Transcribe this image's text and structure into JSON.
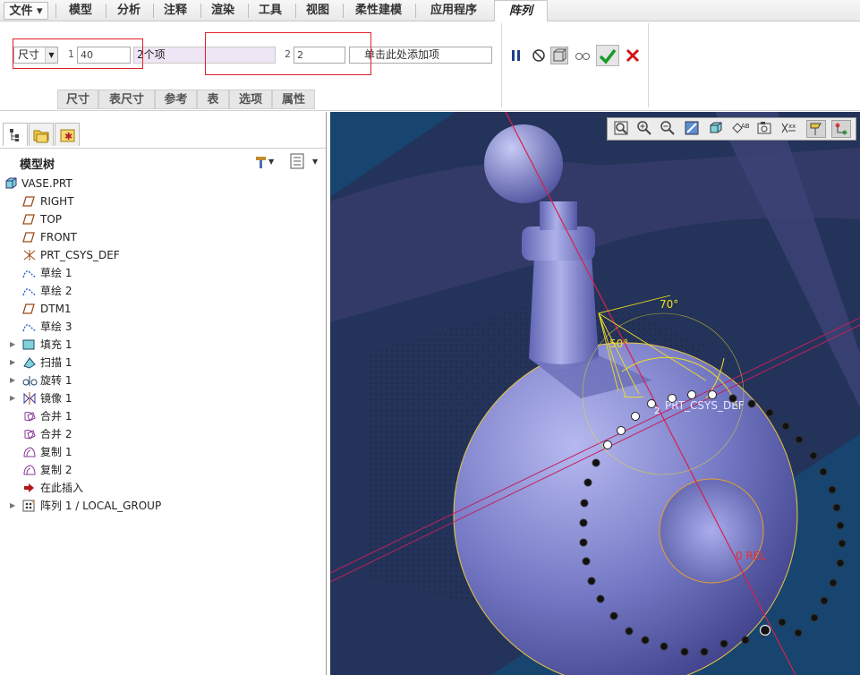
{
  "menubar": {
    "items": [
      "文件 ▾",
      "模型",
      "分析",
      "注释",
      "渲染",
      "工具",
      "视图",
      "柔性建模",
      "应用程序"
    ],
    "active_tab": "阵列"
  },
  "ribbon": {
    "dim_type": "尺寸",
    "dir1_index": "1",
    "dir1_value": "40",
    "dir1_items": "2个项",
    "dir2_index": "2",
    "dir2_value": "2",
    "dir2_hint": "单击此处添加项",
    "subtabs": [
      "尺寸",
      "表尺寸",
      "参考",
      "表",
      "选项",
      "属性"
    ],
    "buttons": {
      "pause": "pause-icon",
      "no_preview": "no-preview-icon",
      "preview": "preview-icon",
      "glasses": "glasses-icon",
      "ok": "checkmark-icon",
      "cancel": "cancel-x-icon"
    },
    "colors": {
      "ok": "#1a9a2a",
      "cancel": "#d01515",
      "highlight_box": "#e0202a"
    }
  },
  "navigator": {
    "title": "模型树",
    "root": "VASE.PRT",
    "items": [
      {
        "label": "RIGHT",
        "icon": "datum-plane-icon",
        "expandable": false
      },
      {
        "label": "TOP",
        "icon": "datum-plane-icon",
        "expandable": false
      },
      {
        "label": "FRONT",
        "icon": "datum-plane-icon",
        "expandable": false
      },
      {
        "label": "PRT_CSYS_DEF",
        "icon": "csys-icon",
        "expandable": false
      },
      {
        "label": "草绘 1",
        "icon": "sketch-icon",
        "expandable": false
      },
      {
        "label": "草绘 2",
        "icon": "sketch-icon",
        "expandable": false
      },
      {
        "label": "DTM1",
        "icon": "datum-plane-icon",
        "expandable": false
      },
      {
        "label": "草绘 3",
        "icon": "sketch-icon",
        "expandable": false
      },
      {
        "label": "填充 1",
        "icon": "fill-icon",
        "expandable": true
      },
      {
        "label": "扫描 1",
        "icon": "sweep-icon",
        "expandable": true
      },
      {
        "label": "旋转 1",
        "icon": "revolve-icon",
        "expandable": true
      },
      {
        "label": "镜像 1",
        "icon": "mirror-icon",
        "expandable": true
      },
      {
        "label": "合并 1",
        "icon": "merge-icon",
        "expandable": false
      },
      {
        "label": "合并 2",
        "icon": "merge-icon",
        "expandable": false
      },
      {
        "label": "复制 1",
        "icon": "copy-icon",
        "expandable": false
      },
      {
        "label": "复制 2",
        "icon": "copy-icon",
        "expandable": false
      },
      {
        "label": "在此插入",
        "icon": "insert-here-icon",
        "expandable": false
      },
      {
        "label": "阵列 1 / LOCAL_GROUP",
        "icon": "pattern-icon",
        "expandable": true
      }
    ]
  },
  "graphics": {
    "angle_label_1": "70°",
    "angle_label_2": "50°",
    "csys_label": "PRT_CSYS_DEF",
    "small_label": "2",
    "rel_label": "0 REL",
    "colors": {
      "background": "#123c62",
      "body": "#7478c4",
      "dimension": "#f0e020",
      "axis": "#d8204a"
    }
  },
  "view_toolbar": [
    "zoom-fit-icon",
    "zoom-in-icon",
    "zoom-out-icon",
    "repaint-icon",
    "display-style-icon",
    "saved-views-icon",
    "perspective-icon",
    "annotation-display-icon",
    "datum-display-icon",
    "spin-center-icon"
  ]
}
